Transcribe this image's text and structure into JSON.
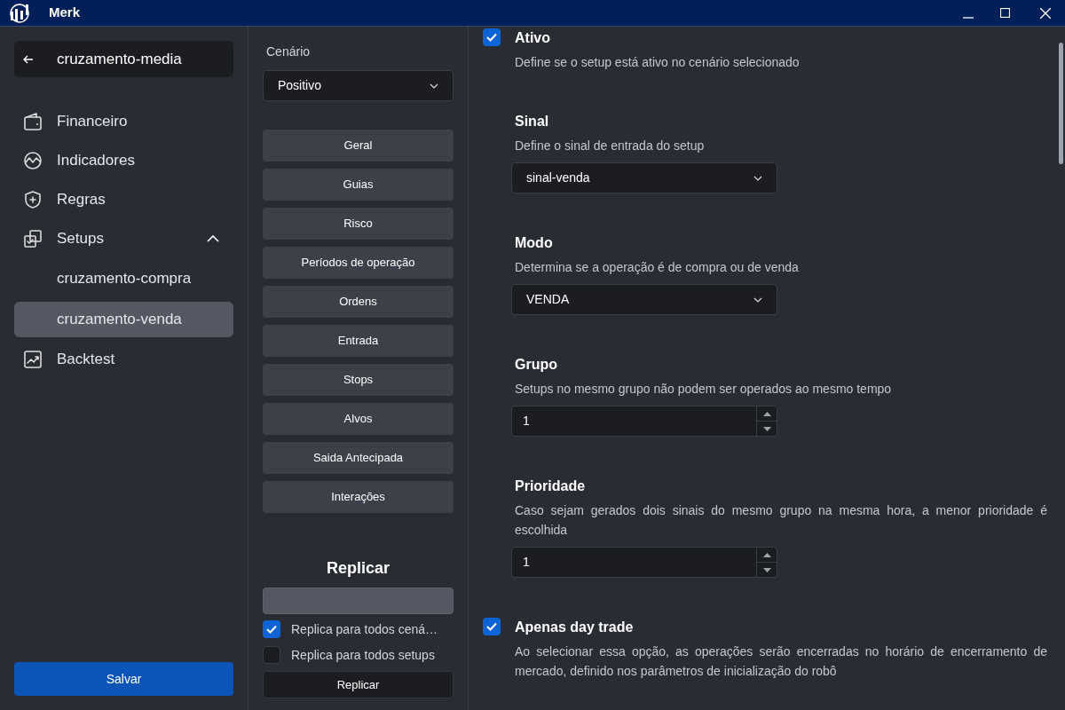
{
  "window": {
    "title": "Merk"
  },
  "sidebar": {
    "back_title": "cruzamento-media",
    "items": [
      {
        "label": "Financeiro",
        "selected": false
      },
      {
        "label": "Indicadores",
        "selected": false
      },
      {
        "label": "Regras",
        "selected": false
      },
      {
        "label": "Setups",
        "selected": false,
        "expanded": true,
        "children": [
          {
            "label": "cruzamento-compra",
            "selected": false
          },
          {
            "label": "cruzamento-venda",
            "selected": true
          }
        ]
      },
      {
        "label": "Backtest",
        "selected": false
      }
    ],
    "save_button": "Salvar"
  },
  "scenario": {
    "label": "Cenário",
    "value": "Positivo"
  },
  "sections": [
    "Geral",
    "Guias",
    "Risco",
    "Períodos de operação",
    "Ordens",
    "Entrada",
    "Stops",
    "Alvos",
    "Saida Antecipada",
    "Interações"
  ],
  "replicate": {
    "title": "Replicar",
    "options": [
      {
        "label": "Replica para todos cená…",
        "checked": true
      },
      {
        "label": "Replica para todos setups",
        "checked": false
      }
    ],
    "button": "Replicar"
  },
  "settings": [
    {
      "kind": "checkbox",
      "title": "Ativo",
      "description": "Define se o setup está ativo no cenário selecionado",
      "checked": true
    },
    {
      "kind": "select",
      "title": "Sinal",
      "description": "Define o sinal de entrada do setup",
      "value": "sinal-venda"
    },
    {
      "kind": "select",
      "title": "Modo",
      "description": "Determina se a operação é de compra ou de venda",
      "value": "VENDA"
    },
    {
      "kind": "number",
      "title": "Grupo",
      "description": "Setups no mesmo grupo não podem ser operados ao mesmo tempo",
      "value": "1"
    },
    {
      "kind": "number",
      "title": "Prioridade",
      "description": "Caso sejam gerados dois sinais do mesmo grupo na mesma hora, a menor prioridade é escolhida",
      "value": "1"
    },
    {
      "kind": "checkbox",
      "title": "Apenas day trade",
      "description": "Ao selecionar essa opção, as operações serão encerradas no horário de encerramento de mercado, definido nos parâmetros de inicialização do robô",
      "checked": true
    }
  ]
}
